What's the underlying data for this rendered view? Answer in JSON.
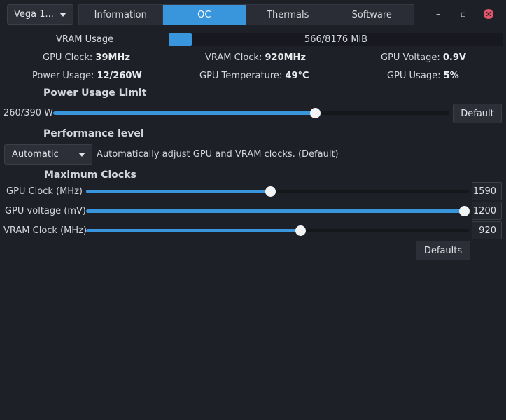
{
  "header": {
    "gpu_select": "Vega 1...",
    "tabs": [
      {
        "label": "Information",
        "active": false
      },
      {
        "label": "OC",
        "active": true
      },
      {
        "label": "Thermals",
        "active": false
      },
      {
        "label": "Software",
        "active": false
      }
    ],
    "window_controls": {
      "minimize": "–",
      "restore": "▫",
      "close": "✕"
    }
  },
  "stats": {
    "vram_usage_label": "VRAM Usage",
    "vram_usage_text": "566/8176 MiB",
    "vram_used": 566,
    "vram_total": 8176,
    "gpu_clock_label": "GPU Clock:",
    "gpu_clock_value": "39MHz",
    "vram_clock_label": "VRAM Clock:",
    "vram_clock_value": "920MHz",
    "gpu_voltage_label": "GPU Voltage:",
    "gpu_voltage_value": "0.9V",
    "power_usage_label": "Power Usage:",
    "power_usage_value": "12/260W",
    "gpu_temp_label": "GPU Temperature:",
    "gpu_temp_value": "49°C",
    "gpu_usage_label": "GPU Usage:",
    "gpu_usage_value": "5%"
  },
  "power_limit": {
    "title": "Power Usage Limit",
    "value_text": "260/390 W",
    "value": 260,
    "max": 390,
    "default_label": "Default"
  },
  "performance": {
    "title": "Performance level",
    "mode": "Automatic",
    "description": "Automatically adjust GPU and VRAM clocks. (Default)"
  },
  "max_clocks": {
    "title": "Maximum Clocks",
    "rows": [
      {
        "label": "GPU Clock (MHz)",
        "value": "1590",
        "fraction": 0.48
      },
      {
        "label": "GPU voltage (mV)",
        "value": "1200",
        "fraction": 1.0
      },
      {
        "label": "VRAM Clock (MHz)",
        "value": "920",
        "fraction": 0.56
      }
    ],
    "defaults_label": "Defaults"
  },
  "colors": {
    "accent": "#3a96dc",
    "background": "#1e2027",
    "close": "#e0556a"
  }
}
